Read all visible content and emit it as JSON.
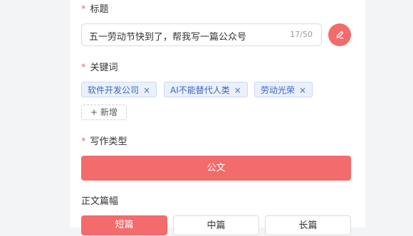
{
  "form": {
    "title_label": "标题",
    "title_value": "五一劳动节快到了，帮我写一篇公众号",
    "title_counter": "17/50",
    "keywords_label": "关键词",
    "keywords": [
      {
        "text": "软件开发公司",
        "remove": "×"
      },
      {
        "text": "AI不能替代人类",
        "remove": "×"
      },
      {
        "text": "劳动光荣",
        "remove": "×"
      }
    ],
    "add_keyword_icon": "+",
    "add_keyword_label": "新增",
    "writing_type_label": "写作类型",
    "writing_type_value": "公文",
    "length_label": "正文篇幅",
    "length_options": [
      "短篇",
      "中篇",
      "长篇"
    ],
    "required_mark": "*"
  },
  "colors": {
    "accent": "#f36b6b",
    "tag_bg": "#eaf0fd",
    "tag_text": "#3b66c4"
  },
  "icons": {
    "edit": "pen-icon"
  }
}
